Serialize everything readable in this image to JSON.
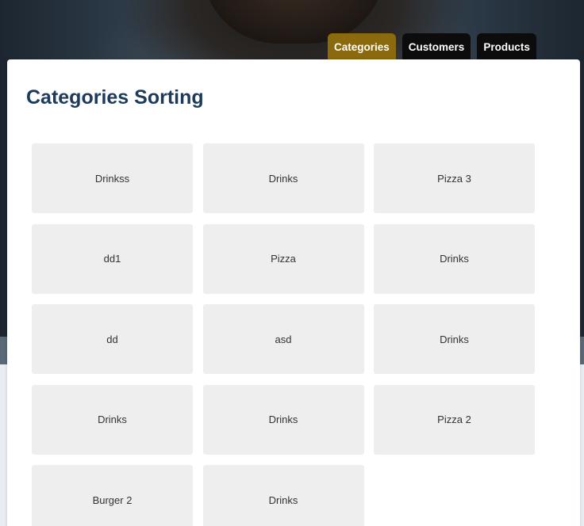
{
  "tabs": [
    {
      "label": "Categories",
      "active": true
    },
    {
      "label": "Customers",
      "active": false
    },
    {
      "label": "Products",
      "active": false
    }
  ],
  "page": {
    "title": "Categories Sorting"
  },
  "categories": [
    "Drinkss",
    "Drinks",
    "Pizza 3",
    "dd1",
    "Pizza",
    "Drinks",
    "dd",
    "asd",
    "Drinks",
    "Drinks",
    "Drinks",
    "Pizza 2",
    "Burger 2",
    "Drinks"
  ],
  "colors": {
    "active_tab": "#8a6a0c",
    "tab": "#0c0c0c",
    "title": "#1d3a5a",
    "tile": "#eeeeee"
  }
}
